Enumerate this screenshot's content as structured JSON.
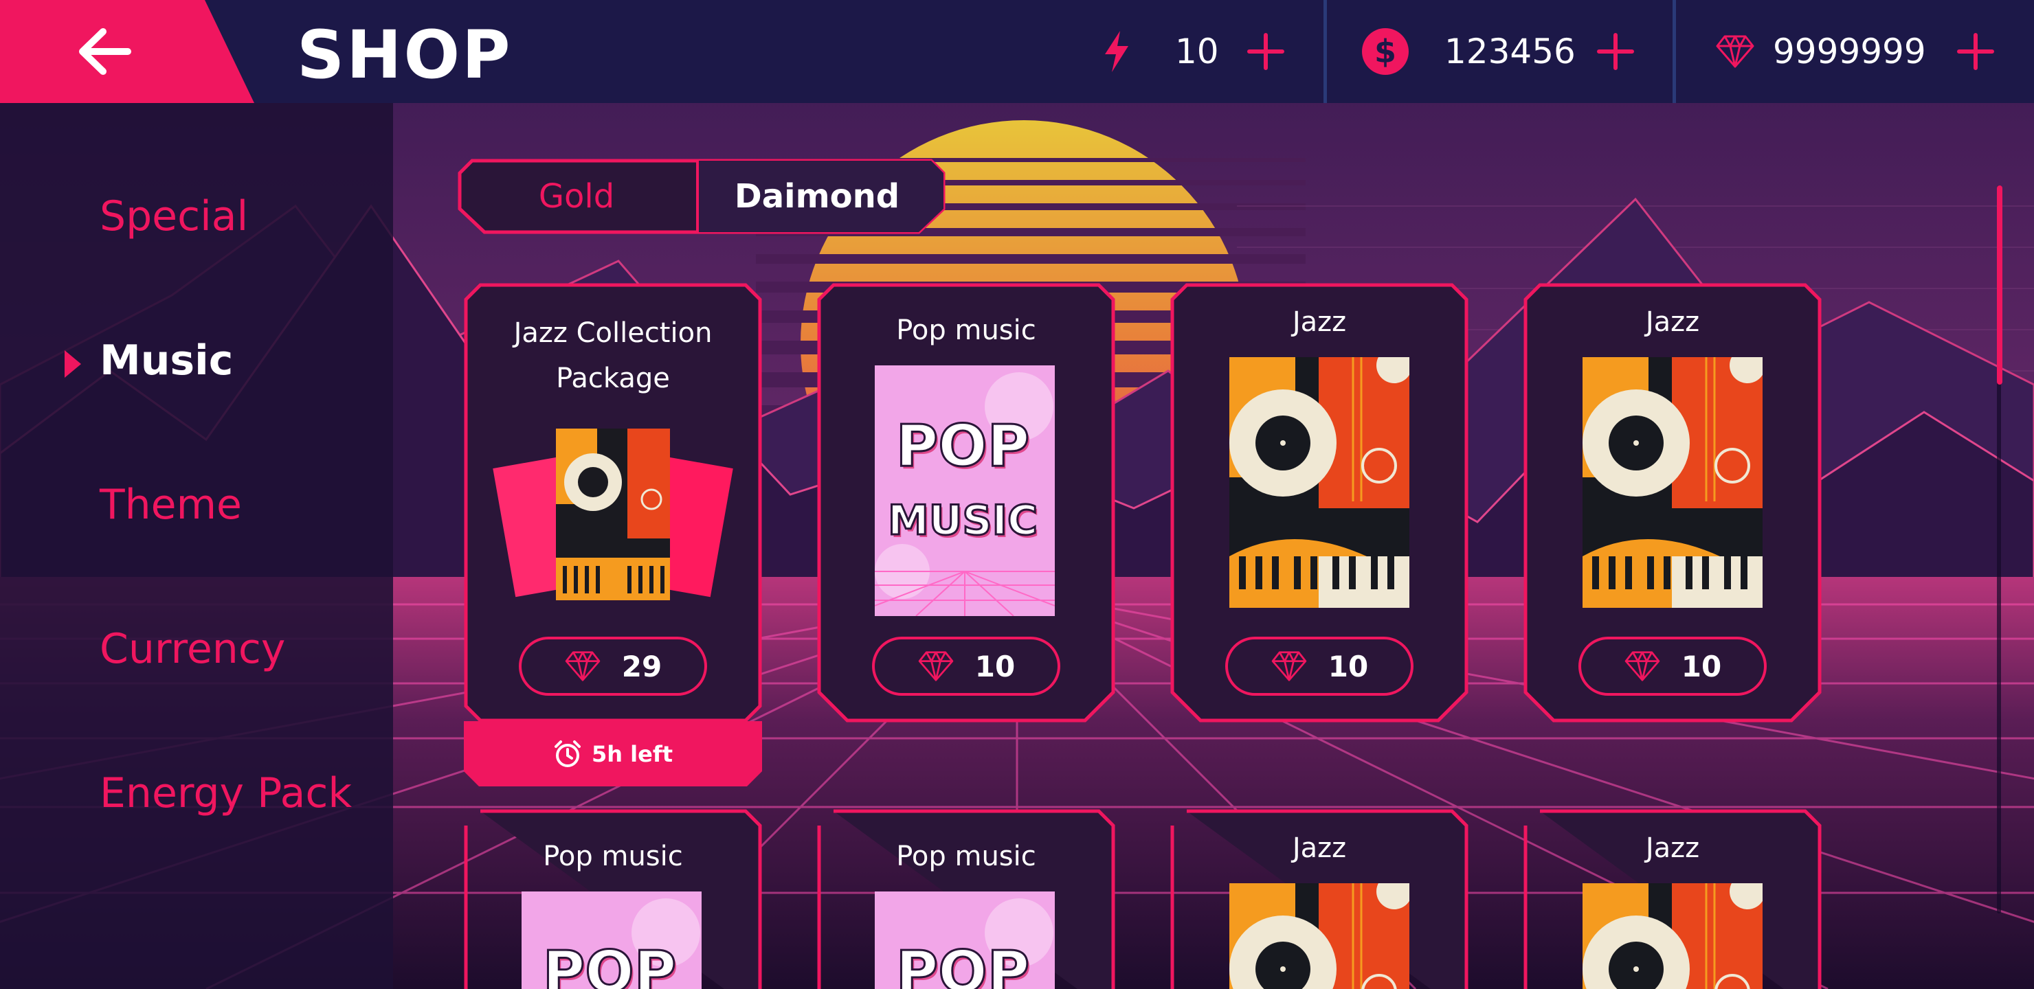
{
  "header": {
    "title": "SHOP",
    "energy": {
      "value": "10",
      "icon": "lightning-icon"
    },
    "coins": {
      "value": "123456",
      "icon": "dollar-coin-icon"
    },
    "diamonds": {
      "value": "9999999",
      "icon": "diamond-icon"
    }
  },
  "sidebar": {
    "items": [
      {
        "label": "Special"
      },
      {
        "label": "Music"
      },
      {
        "label": "Theme"
      },
      {
        "label": "Currency"
      },
      {
        "label": "Energy Pack"
      }
    ],
    "active_index": 1
  },
  "tabs": [
    {
      "label": "Gold"
    },
    {
      "label": "Daimond"
    }
  ],
  "selected_tab": "Daimond",
  "products": [
    {
      "title": "Jazz Collection Package",
      "price": "29",
      "badge": "5h left"
    },
    {
      "title": "Pop music",
      "price": "10"
    },
    {
      "title": "Jazz",
      "price": "10"
    },
    {
      "title": "Jazz",
      "price": "10"
    },
    {
      "title": "Pop music"
    },
    {
      "title": "Pop music"
    },
    {
      "title": "Jazz"
    },
    {
      "title": "Jazz"
    }
  ],
  "colors": {
    "accent": "#f0165f",
    "topbar": "#1c1848",
    "sidebar": "#1e1034",
    "card": "#2a1538"
  }
}
